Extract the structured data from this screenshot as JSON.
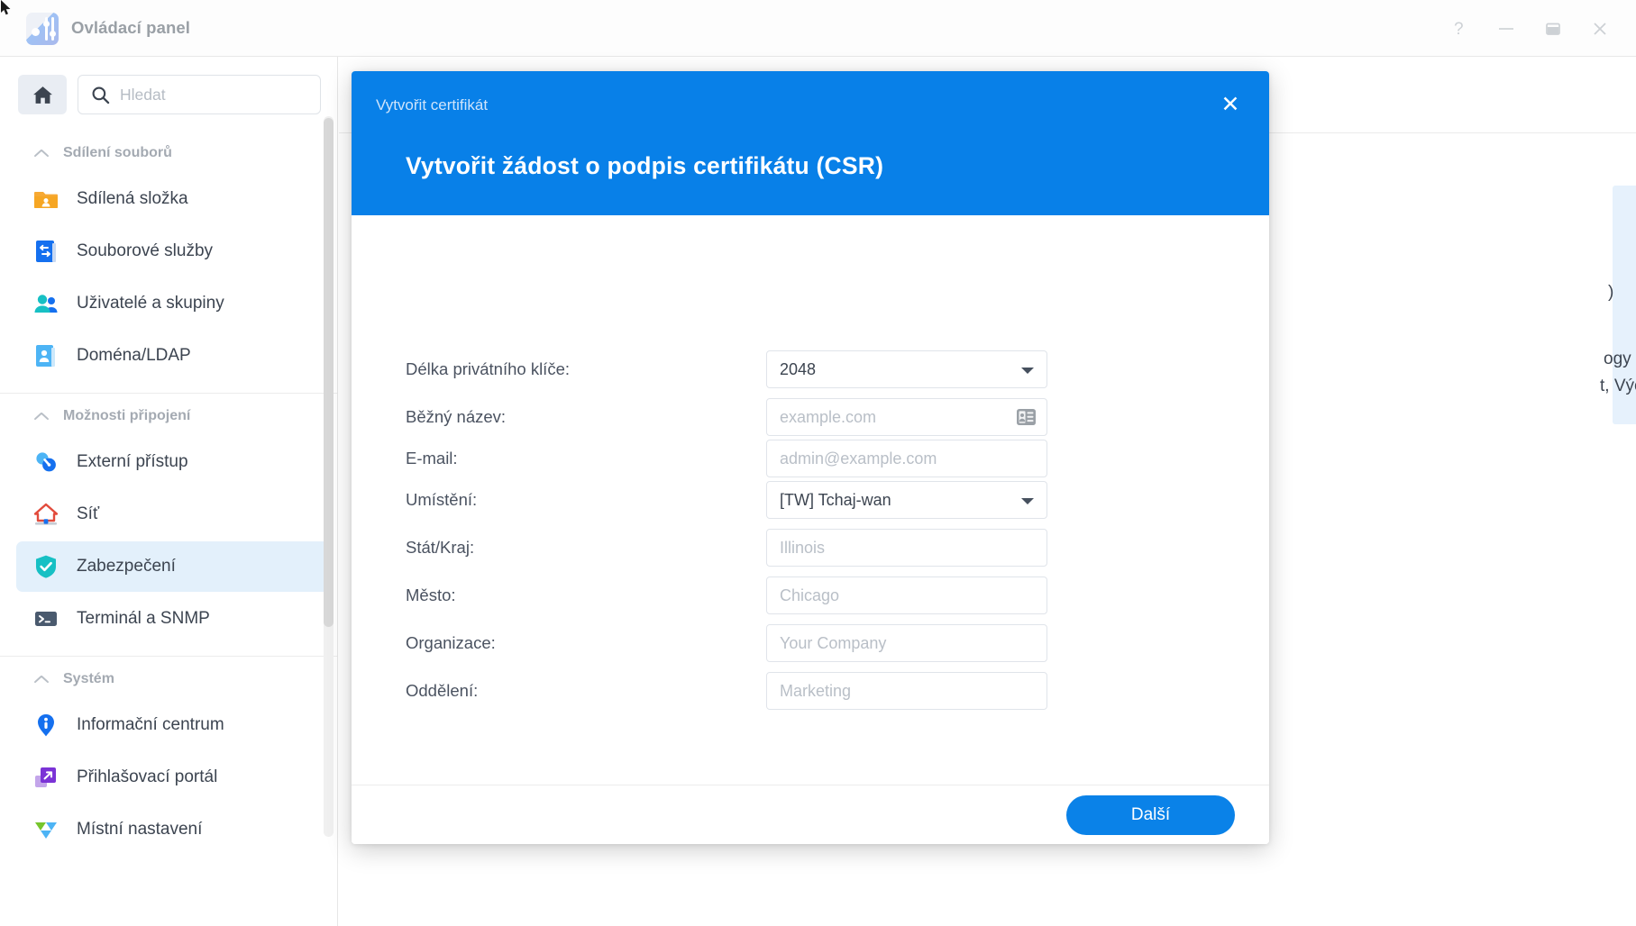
{
  "window": {
    "title": "Ovládací panel",
    "app_icon": "control-panel-icon",
    "controls": {
      "help": "?",
      "minimize": "–",
      "maximize": "□",
      "close": "✕"
    }
  },
  "sidebar": {
    "home_label": "home-icon",
    "search": {
      "placeholder": "Hledat",
      "value": ""
    },
    "sections": [
      {
        "title": "Sdílení souborů",
        "items": [
          {
            "label": "Sdílená složka",
            "icon": "shared-folder-icon",
            "selected": false
          },
          {
            "label": "Souborové služby",
            "icon": "file-services-icon",
            "selected": false
          },
          {
            "label": "Uživatelé a skupiny",
            "icon": "users-groups-icon",
            "selected": false
          },
          {
            "label": "Doména/LDAP",
            "icon": "domain-ldap-icon",
            "selected": false
          }
        ]
      },
      {
        "title": "Možnosti připojení",
        "items": [
          {
            "label": "Externí přístup",
            "icon": "external-access-icon",
            "selected": false
          },
          {
            "label": "Síť",
            "icon": "network-icon",
            "selected": false
          },
          {
            "label": "Zabezpečení",
            "icon": "security-shield-icon",
            "selected": true
          },
          {
            "label": "Terminál a SNMP",
            "icon": "terminal-snmp-icon",
            "selected": false
          }
        ]
      },
      {
        "title": "Systém",
        "items": [
          {
            "label": "Informační centrum",
            "icon": "info-center-icon",
            "selected": false
          },
          {
            "label": "Přihlašovací portál",
            "icon": "login-portal-icon",
            "selected": false
          },
          {
            "label": "Místní nastavení",
            "icon": "regional-options-icon",
            "selected": false
          }
        ]
      }
    ]
  },
  "background_card": {
    "line1": ")",
    "line2": "ogy Drive Server,",
    "line3": "t, Výchozí nastavení",
    "collapse_icon": "chevron-up-icon"
  },
  "dialog": {
    "window_title": "Vytvořit certifikát",
    "heading": "Vytvořit žádost o podpis certifikátu (CSR)",
    "close_icon": "✕",
    "fields": [
      {
        "label": "Délka privátního klíče:",
        "type": "select",
        "value": "2048",
        "placeholder": ""
      },
      {
        "label": "Běžný název:",
        "type": "text-with-icon",
        "value": "",
        "placeholder": "example.com",
        "icon": "contact-card-icon"
      },
      {
        "label": "E-mail:",
        "type": "text",
        "value": "",
        "placeholder": "admin@example.com"
      },
      {
        "label": "Umístění:",
        "type": "select",
        "value": "[TW] Tchaj-wan",
        "placeholder": ""
      },
      {
        "label": "Stát/Kraj:",
        "type": "text",
        "value": "",
        "placeholder": "Illinois"
      },
      {
        "label": "Město:",
        "type": "text",
        "value": "",
        "placeholder": "Chicago"
      },
      {
        "label": "Organizace:",
        "type": "text",
        "value": "",
        "placeholder": "Your Company"
      },
      {
        "label": "Oddělení:",
        "type": "text",
        "value": "",
        "placeholder": "Marketing"
      }
    ],
    "next_button": "Další"
  },
  "colors": {
    "header_blue": "#0880e8",
    "button_blue": "#0a82e8",
    "selected_item_bg": "#e3f0fb",
    "card_bg": "#e6f1fc"
  }
}
